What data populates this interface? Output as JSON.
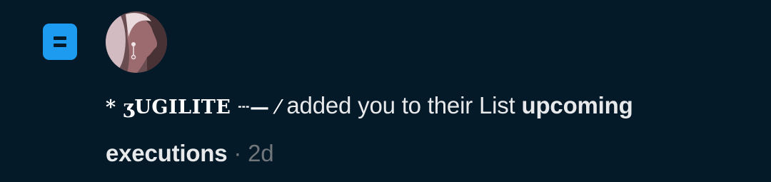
{
  "notification": {
    "type_icon": "list-icon",
    "avatar": "user-avatar",
    "user_name": "* ʒUGILITE ┄— ⁄",
    "action": " added you to their List ",
    "list_name": "upcoming executions",
    "separator": " · ",
    "time": "2d"
  },
  "colors": {
    "background": "#051a29",
    "accent": "#1d9bf0",
    "text": "#e7e9ea",
    "muted": "#71767b"
  }
}
